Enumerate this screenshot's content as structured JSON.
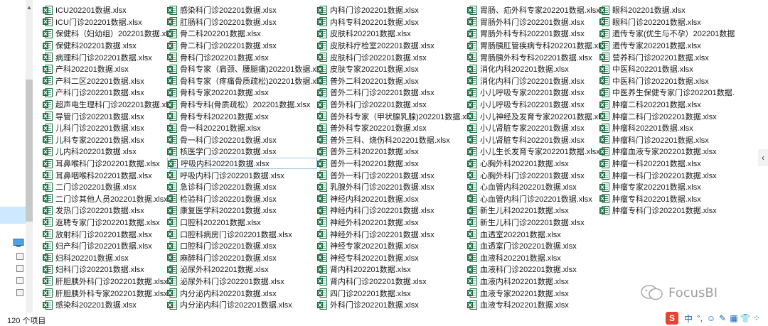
{
  "status": {
    "item_count": "120 个项目"
  },
  "watermark": {
    "text": "FocusBI"
  },
  "ime": {
    "logo": "S",
    "items": [
      "中",
      "°,",
      "☺",
      "✎",
      "▦",
      "👕",
      "⁘"
    ]
  },
  "files": [
    "ICU202201数据.xlsx",
    "ICU门诊202201数据.xlsx",
    "保健科（妇幼组）202201数据.xlsx",
    "保健科202201数据.xlsx",
    "病理科门诊202201数据.xlsx",
    "产科202201数据.xlsx",
    "产科二区202201数据.xlsx",
    "产科门诊202201数据.xlsx",
    "超声电生理科门诊202201数据.xlsx",
    "导管门诊202201数据.xlsx",
    "儿科门诊202201数据.xlsx",
    "儿科专家202201数据.xlsx",
    "儿内科202201数据.xlsx",
    "耳鼻喉科门诊202201数据.xlsx",
    "耳鼻咽喉科202201数据.xlsx",
    "二门诊202201数据.xlsx",
    "二门诊其他人员202201数据.xlsx",
    "发热门诊202201数据.xlsx",
    "返聘专家门诊202201数据.xlsx",
    "放射科门诊202201数据.xlsx",
    "妇产科门诊202201数据.xlsx",
    "妇科202201数据.xlsx",
    "妇科门诊202201数据.xlsx",
    "肝胆胰外科门诊202201数据.xlsx",
    "肝胆胰外科专家202201数据.xlsx",
    "感染科202201数据.xlsx",
    "感染科门诊202201数据.xlsx",
    "肛肠科门诊202201数据.xlsx",
    "骨二科202201数据.xlsx",
    "骨二科门诊202201数据.xlsx",
    "骨科门诊202201数据.xlsx",
    "骨科专家（肩颈、腰腿痛)202201数据.xlsx",
    "骨科专家（疼痛骨质疏松)202201数据.xlsx",
    "骨科专家202201数据.xlsx",
    "骨科专科(骨质疏松）202201数据.xlsx",
    "骨科专科202201数据.xlsx",
    "骨一科202201数据.xlsx",
    "骨一科门诊202201数据.xlsx",
    "核医学门诊202201数据.xlsx",
    "呼吸内科202201数据.xlsx",
    "呼吸内科门诊202201数据.xlsx",
    "急诊科门诊202201数据.xlsx",
    "检验科门诊202201数据.xlsx",
    "康复医学科202201数据.xlsx",
    "口腔科202201数据.xlsx",
    "口腔科病房门诊202201数据.xlsx",
    "口腔科门诊202201数据.xlsx",
    "麻醉科门诊202201数据.xlsx",
    "泌尿外科202201数据.xlsx",
    "泌尿外科门诊202201数据.xlsx",
    "内分泌内科202201数据.xlsx",
    "内分泌内科门诊202201数据.xlsx",
    "内科门诊202201数据.xlsx",
    "内科专科202201数据.xlsx",
    "皮肤科202201数据.xlsx",
    "皮肤科疗检室202201数据.xlsx",
    "皮肤科门诊202201数据.xlsx",
    "皮肤专家202201数据.xlsx",
    "普外二科202201数据.xlsx",
    "普外二科门诊202201数据.xlsx",
    "普外科门诊202201数据.xlsx",
    "普外科专家（甲状腺乳腺)202201数据.xlsx",
    "普外科专家202201数据.xlsx",
    "普外三科、烧伤科202201数据.xlsx",
    "普外三科202201数据.xlsx",
    "普外一科202201数据.xlsx",
    "普外一科门诊202201数据.xlsx",
    "乳腺外科门诊202201数据.xlsx",
    "神经内科202201数据.xlsx",
    "神经内科门诊202201数据.xlsx",
    "神经外科202201数据.xlsx",
    "神经外科门诊202201数据.xlsx",
    "神经专家202201数据.xlsx",
    "神经专科202201数据.xlsx",
    "肾内科202201数据.xlsx",
    "肾内科门诊202201数据.xlsx",
    "四门诊202201数据.xlsx",
    "外科门诊202201数据.xlsx",
    "胃肠、疝外科专家202201数据.xlsx",
    "胃肠外科门诊202201数据.xlsx",
    "胃肠外科专科202201数据.xlsx",
    "胃肠胰肛管疾病专科202201数据.xlsx",
    "胃肠胰外科专科202201数据.xlsx",
    "消化内科202201数据.xlsx",
    "消化内科门诊202201数据.xlsx",
    "小儿呼吸专家202201数据.xlsx",
    "小儿呼吸专科202201数据.xlsx",
    "小儿神经及发育专家202201数据.xlsx",
    "小儿肾脏专家202201数据.xlsx",
    "小儿肾脏专科202201数据.xlsx",
    "小儿生长发育专家202201数据.xlsx",
    "心胸外科202201数据.xlsx",
    "心胸外科门诊202201数据.xlsx",
    "心血管内科202201数据.xlsx",
    "心血管内科门诊202201数据.xlsx",
    "新生儿科202201数据.xlsx",
    "新生儿科门诊202201数据.xlsx",
    "血透室202201数据.xlsx",
    "血透室门诊202201数据.xlsx",
    "血液科202201数据.xlsx",
    "血液科门诊202201数据.xlsx",
    "血液内科202201数据.xlsx",
    "血液专家202201数据.xlsx",
    "血液专科202201数据.xlsx",
    "眼科202201数据.xlsx",
    "眼科门诊202201数据.xlsx",
    "遗传专家(优生与不孕）202201数据.xlsx",
    "遗传专家202201数据.xlsx",
    "营养科门诊202201数据.xlsx",
    "中医科202201数据.xlsx",
    "中医科门诊202201数据.xlsx",
    "中医养生保健专家门诊202201数据.xlsx",
    "肿瘤二科202201数据.xlsx",
    "肿瘤二科门诊202201数据.xlsx",
    "肿瘤科202201数据.xlsx",
    "肿瘤科门诊202201数据.xlsx",
    "肿瘤血液专家202201数据.xlsx",
    "肿瘤一科202201数据.xlsx",
    "肿瘤一科门诊202201数据.xlsx",
    "肿瘤专家202201数据.xlsx",
    "肿瘤专科202201数据.xlsx",
    "肿瘤专科门诊202201数据.xlsx"
  ],
  "selected_file_index": 39
}
